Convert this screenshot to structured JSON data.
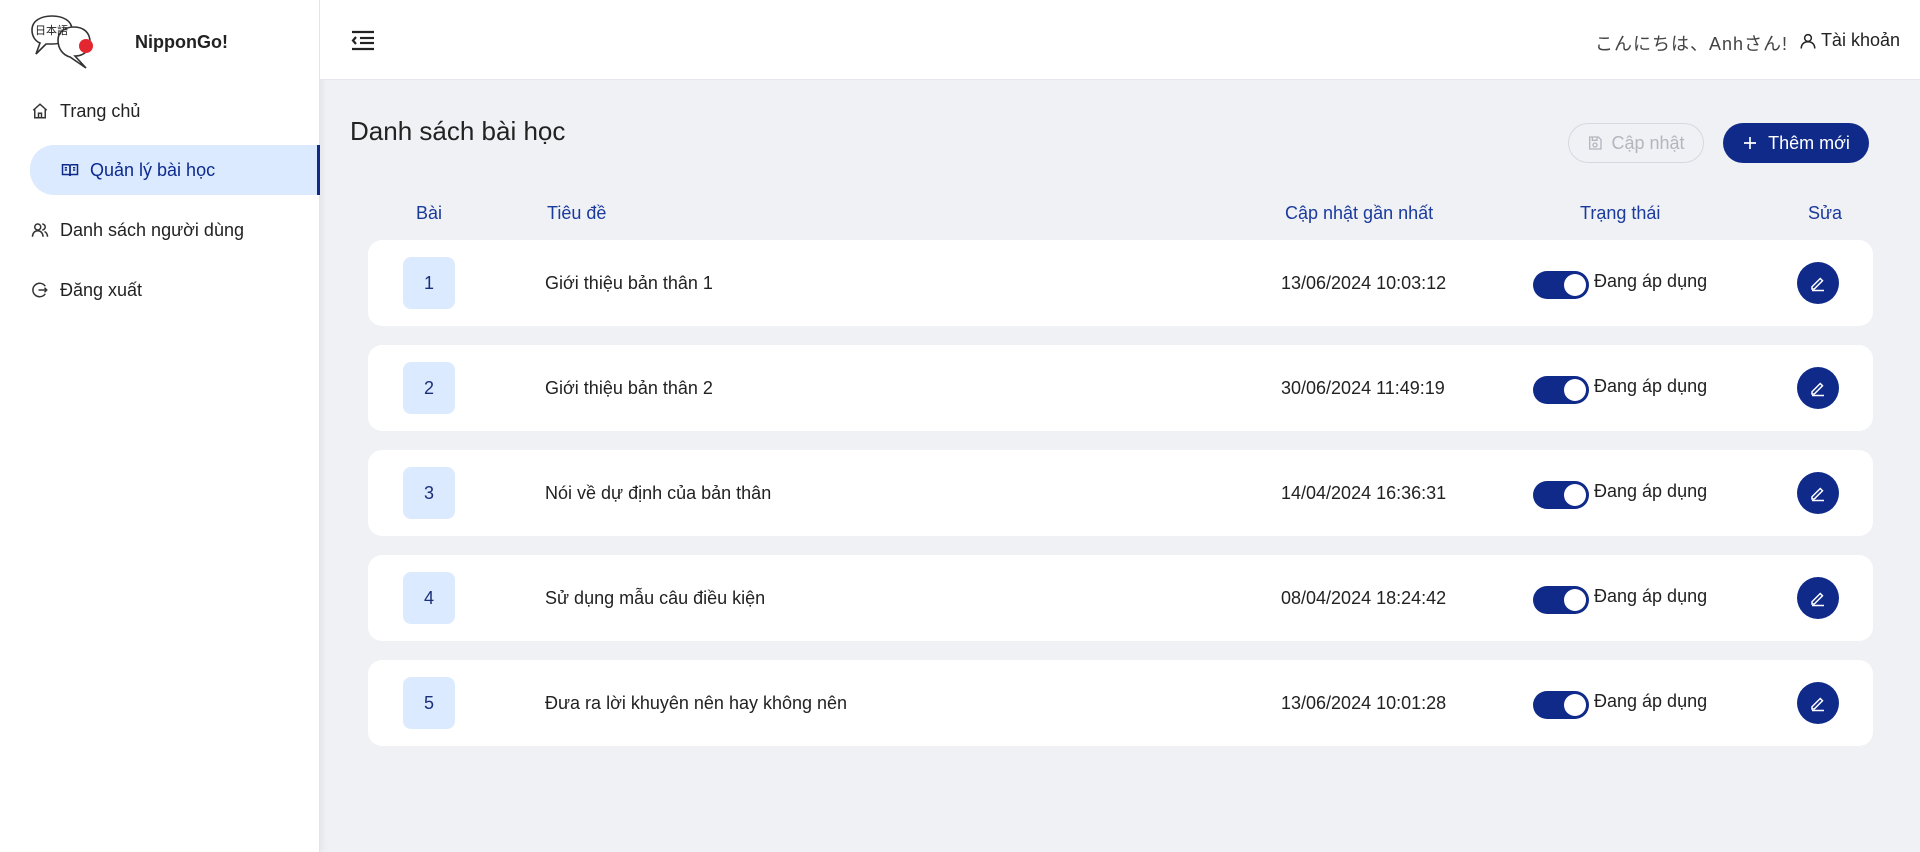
{
  "brand": {
    "name": "NipponGo!",
    "logo_text": "日本語"
  },
  "sidebar": {
    "items": [
      {
        "label": "Trang chủ",
        "icon": "home-icon"
      },
      {
        "label": "Quản lý bài học",
        "icon": "book-icon",
        "active": true
      },
      {
        "label": "Danh sách người dùng",
        "icon": "users-icon"
      },
      {
        "label": "Đăng xuất",
        "icon": "logout-icon"
      }
    ]
  },
  "header": {
    "greeting": "こんにちは、Anhさん!",
    "account_label": "Tài khoản"
  },
  "main": {
    "title": "Danh sách bài học",
    "update_label": "Cập nhật",
    "add_label": "Thêm mới",
    "columns": {
      "lesson": "Bài",
      "title": "Tiêu đề",
      "updated": "Cập nhật gần nhất",
      "status": "Trạng thái",
      "edit": "Sửa"
    },
    "rows": [
      {
        "num": "1",
        "title": "Giới thiệu bản thân 1",
        "updated": "13/06/2024 10:03:12",
        "status": "Đang áp dụng",
        "enabled": true
      },
      {
        "num": "2",
        "title": "Giới thiệu bản thân 2",
        "updated": "30/06/2024 11:49:19",
        "status": "Đang áp dụng",
        "enabled": true
      },
      {
        "num": "3",
        "title": "Nói về dự định của bản thân",
        "updated": "14/04/2024 16:36:31",
        "status": "Đang áp dụng",
        "enabled": true
      },
      {
        "num": "4",
        "title": "Sử dụng mẫu câu điều kiện",
        "updated": "08/04/2024 18:24:42",
        "status": "Đang áp dụng",
        "enabled": true
      },
      {
        "num": "5",
        "title": "Đưa ra lời khuyên nên hay không nên",
        "updated": "13/06/2024 10:01:28",
        "status": "Đang áp dụng",
        "enabled": true
      }
    ]
  },
  "colors": {
    "accent": "#102a8a",
    "active_bg": "#dbeafe",
    "page_bg": "#eff1f5"
  }
}
